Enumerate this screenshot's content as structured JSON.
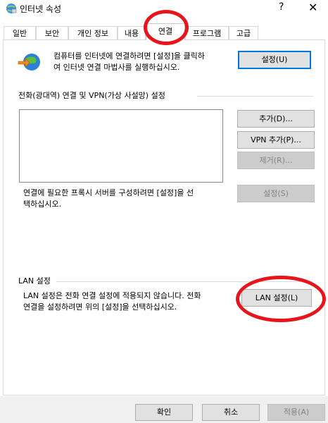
{
  "window": {
    "title": "인터넷 속성",
    "help_glyph": "?",
    "close_glyph": "✕"
  },
  "tabs": [
    {
      "label": "일반"
    },
    {
      "label": "보안"
    },
    {
      "label": "개인 정보"
    },
    {
      "label": "내용"
    },
    {
      "label": "연결"
    },
    {
      "label": "프로그램"
    },
    {
      "label": "고급"
    }
  ],
  "setup": {
    "text_line1": "컴퓨터를 인터넷에 연결하려면 [설정]을 클릭하",
    "text_line2": "여 인터넷 연결 마법사를 실행하십시오.",
    "button": "설정(U)"
  },
  "dialup": {
    "heading": "전화(광대역) 연결 및 VPN(가상 사설망) 설정",
    "add_button": "추가(D)...",
    "vpn_button": "VPN 추가(P)...",
    "remove_button": "제거(R)...",
    "proxy_line1": "연결에 필요한 프록시 서버를 구성하려면 [설정]을 선",
    "proxy_line2": "택하십시오.",
    "settings_button": "설정(S)"
  },
  "lan": {
    "heading": "LAN 설정",
    "text_line1": "LAN 설정은 전화 연결 설정에 적용되지 않습니다. 전화",
    "text_line2": "연결을 설정하려면 위의 [설정]을 선택하십시오.",
    "button": "LAN 설정(L)"
  },
  "footer": {
    "ok": "확인",
    "cancel": "취소",
    "apply": "적용(A)"
  },
  "colors": {
    "annotation_ring": "#e8141b",
    "default_button_border": "#0078d7"
  }
}
